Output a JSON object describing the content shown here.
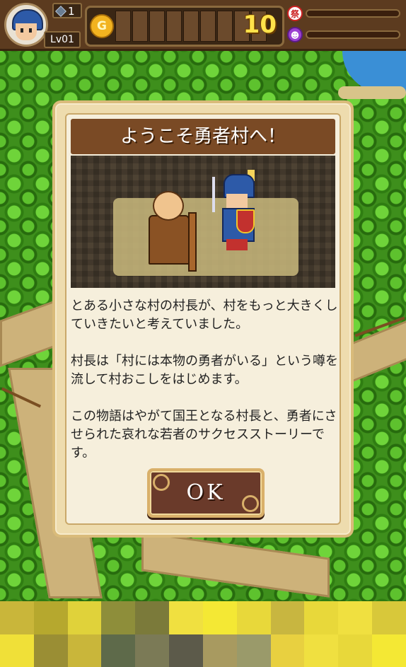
{
  "header": {
    "gem_count": "1",
    "level": "Lv01",
    "coin_symbol": "G",
    "coin_count": "10",
    "festival_icon_label": "祭",
    "icons": [
      "avatar-hero",
      "gem-icon",
      "coin-icon",
      "festival-icon",
      "demon-icon"
    ]
  },
  "dialog": {
    "title": "ようこそ勇者村へ！",
    "paragraphs": [
      "とある小さな村の村長が、村をもっと大きくしていきたいと考えていました。",
      "村長は「村には本物の勇者がいる」という噂を流して村おこしをはじめます。",
      "この物語はやがて国王となる村長と、勇者にさせられた哀れな若者のサクセスストーリーです。"
    ],
    "ok_label": "OK"
  },
  "colors": {
    "frame_brown": "#5c3b1f",
    "title_brown": "#7a4a25",
    "panel_cream": "#f6efdc",
    "coin_gold": "#ffe24a",
    "forest_green": "#3e8f1c"
  },
  "ad_banner": {
    "colors": [
      "#c9b63a",
      "#b6a82e",
      "#e0d23a",
      "#8e8e3a",
      "#7b7a3a",
      "#f0e040",
      "#f4e834",
      "#e8d83a",
      "#c8b640",
      "#e8d83a",
      "#f0e040",
      "#d8c83a",
      "#f0e038",
      "#9a8e34",
      "#c9b63a",
      "#5e6a4a",
      "#7b7a56",
      "#5c5a4a",
      "#a89a60",
      "#9a9a6a",
      "#e8d040",
      "#f0e040",
      "#e8d83a",
      "#f4e834"
    ]
  }
}
